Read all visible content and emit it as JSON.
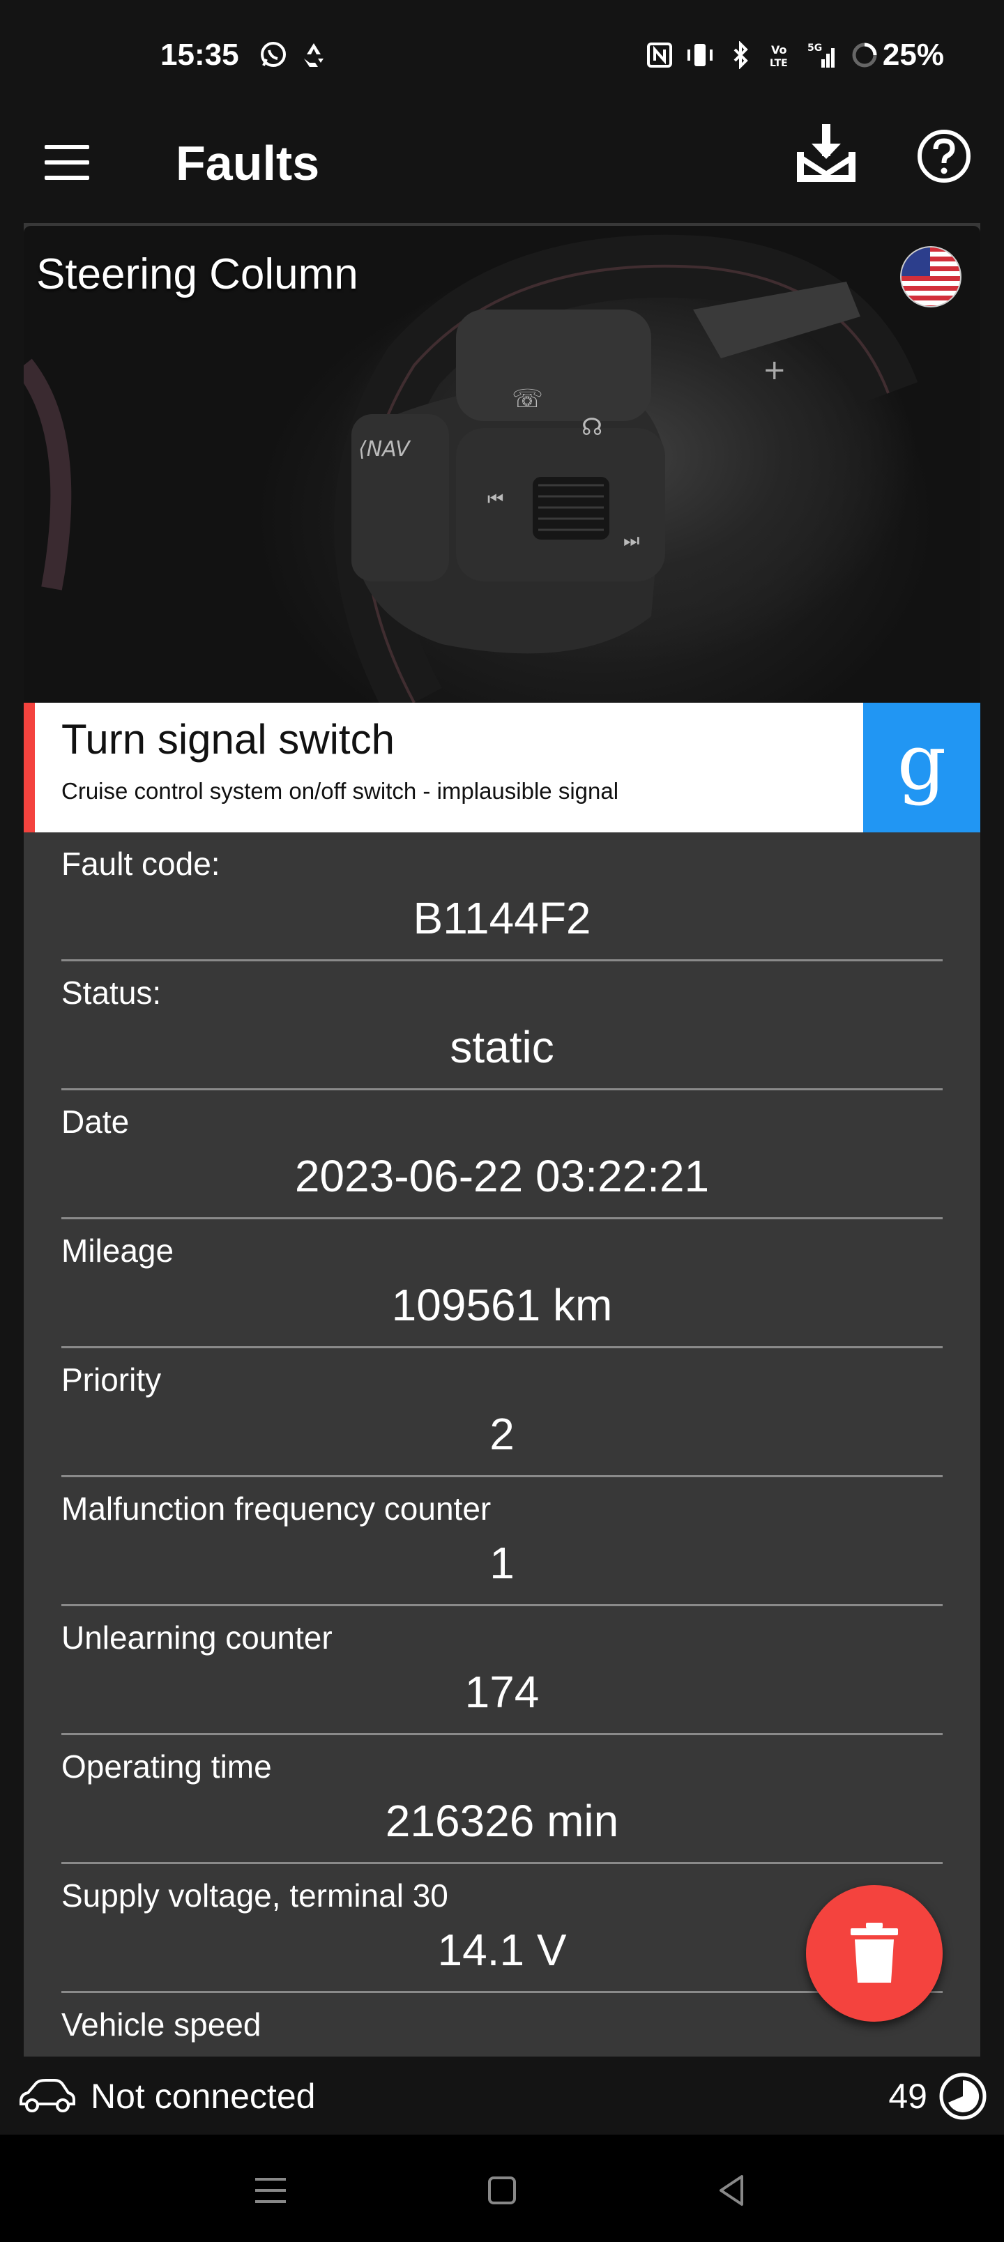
{
  "status_bar": {
    "time": "15:35",
    "battery": "25%",
    "network": "5G",
    "icons": [
      "whatsapp-icon",
      "recycle-icon",
      "nfc-icon",
      "vibrate-icon",
      "bluetooth-icon",
      "volte-icon",
      "signal-icon",
      "battery-ring-icon"
    ]
  },
  "app_bar": {
    "title": "Faults",
    "icons": [
      "menu-icon",
      "download-icon",
      "help-icon"
    ]
  },
  "hero": {
    "title": "Steering Column",
    "flag_icon": "us-flag-icon"
  },
  "fault": {
    "name": "Turn signal switch",
    "description": "Cruise control system on/off switch - implausible signal",
    "search_label": "g"
  },
  "fields": [
    {
      "label": "Fault code:",
      "value": "B1144F2"
    },
    {
      "label": "Status:",
      "value": "static"
    },
    {
      "label": "Date",
      "value": "2023-06-22 03:22:21"
    },
    {
      "label": "Mileage",
      "value": "109561 km"
    },
    {
      "label": "Priority",
      "value": "2"
    },
    {
      "label": "Malfunction frequency counter",
      "value": "1"
    },
    {
      "label": "Unlearning counter",
      "value": "174"
    },
    {
      "label": "Operating time",
      "value": "216326 min"
    },
    {
      "label": "Supply voltage, terminal 30",
      "value": "14.1 V"
    },
    {
      "label": "Vehicle speed",
      "value": ""
    }
  ],
  "bottom_bar": {
    "connection": "Not connected",
    "count": "49"
  },
  "colors": {
    "accent_red": "#f4433e",
    "google_blue": "#2196f3",
    "card_bg": "#383838",
    "bar_bg": "#141414"
  }
}
